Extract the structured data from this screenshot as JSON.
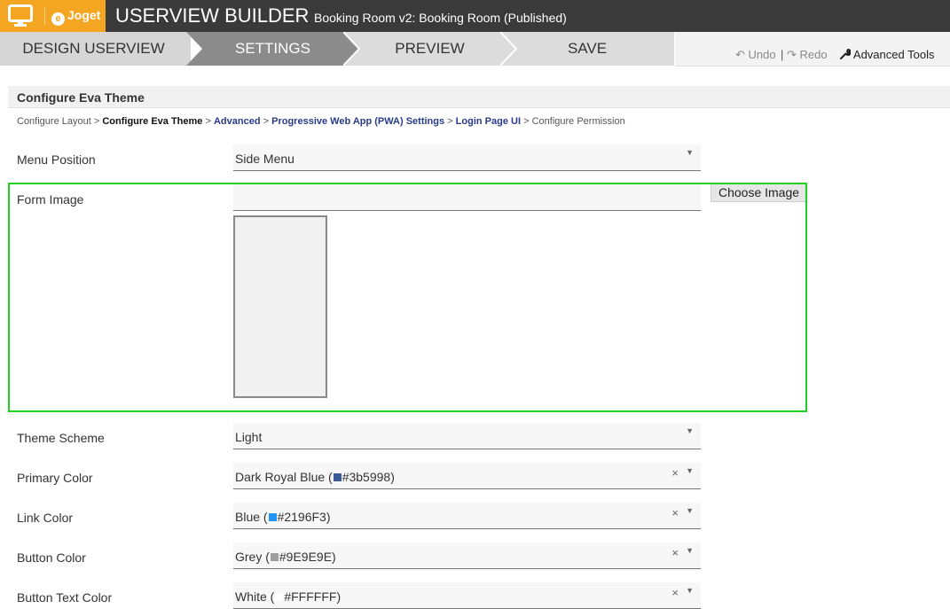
{
  "header": {
    "logo_text": "Joget",
    "title": "USERVIEW BUILDER",
    "subtitle": "Booking Room v2: Booking Room (Published)"
  },
  "steps": [
    "DESIGN USERVIEW",
    "SETTINGS",
    "PREVIEW",
    "SAVE"
  ],
  "active_step": "SETTINGS",
  "tools": {
    "undo": "Undo",
    "separator": "|",
    "redo": "Redo",
    "advanced": "Advanced Tools"
  },
  "panel": {
    "title": "Configure Eva Theme"
  },
  "breadcrumb": {
    "items": [
      "Configure Layout",
      "Configure Eva Theme",
      "Advanced",
      "Progressive Web App (PWA) Settings",
      "Login Page UI",
      "Configure Permission"
    ],
    "separator": ">"
  },
  "fields": {
    "menu_position": {
      "label": "Menu Position",
      "value": "Side Menu"
    },
    "form_image": {
      "label": "Form Image",
      "value": "",
      "button": "Choose Image"
    },
    "theme_scheme": {
      "label": "Theme Scheme",
      "value": "Light"
    },
    "primary_color": {
      "label": "Primary Color",
      "name": "Dark Royal Blue (",
      "hex": "#3b5998)",
      "color": "#3b5998"
    },
    "link_color": {
      "label": "Link Color",
      "name": "Blue (",
      "hex": "#2196F3)",
      "color": "#2196F3"
    },
    "button_color": {
      "label": "Button Color",
      "name": "Grey (",
      "hex": "#9E9E9E)",
      "color": "#9E9E9E"
    },
    "button_text_color": {
      "label": "Button Text Color",
      "name": "White (",
      "hex": "#FFFFFF)",
      "color": "#FFFFFF"
    }
  },
  "icons": {
    "close": "×",
    "dropdown": "▼",
    "undo": "↶",
    "redo": "↷",
    "wrench": "wrench-icon"
  }
}
